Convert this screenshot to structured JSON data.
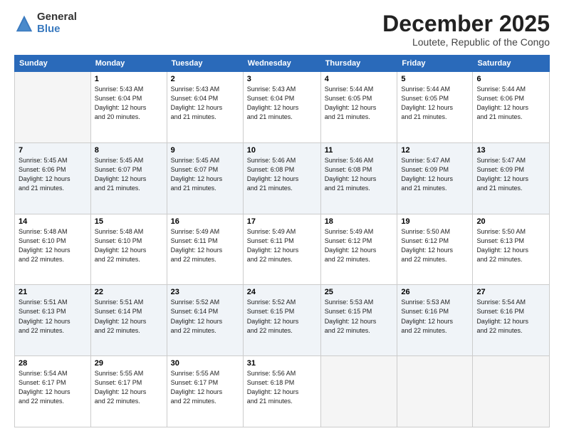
{
  "logo": {
    "general": "General",
    "blue": "Blue"
  },
  "title": "December 2025",
  "location": "Loutete, Republic of the Congo",
  "days_header": [
    "Sunday",
    "Monday",
    "Tuesday",
    "Wednesday",
    "Thursday",
    "Friday",
    "Saturday"
  ],
  "weeks": [
    [
      {
        "num": "",
        "info": ""
      },
      {
        "num": "1",
        "info": "Sunrise: 5:43 AM\nSunset: 6:04 PM\nDaylight: 12 hours\nand 20 minutes."
      },
      {
        "num": "2",
        "info": "Sunrise: 5:43 AM\nSunset: 6:04 PM\nDaylight: 12 hours\nand 21 minutes."
      },
      {
        "num": "3",
        "info": "Sunrise: 5:43 AM\nSunset: 6:04 PM\nDaylight: 12 hours\nand 21 minutes."
      },
      {
        "num": "4",
        "info": "Sunrise: 5:44 AM\nSunset: 6:05 PM\nDaylight: 12 hours\nand 21 minutes."
      },
      {
        "num": "5",
        "info": "Sunrise: 5:44 AM\nSunset: 6:05 PM\nDaylight: 12 hours\nand 21 minutes."
      },
      {
        "num": "6",
        "info": "Sunrise: 5:44 AM\nSunset: 6:06 PM\nDaylight: 12 hours\nand 21 minutes."
      }
    ],
    [
      {
        "num": "7",
        "info": "Sunrise: 5:45 AM\nSunset: 6:06 PM\nDaylight: 12 hours\nand 21 minutes."
      },
      {
        "num": "8",
        "info": "Sunrise: 5:45 AM\nSunset: 6:07 PM\nDaylight: 12 hours\nand 21 minutes."
      },
      {
        "num": "9",
        "info": "Sunrise: 5:45 AM\nSunset: 6:07 PM\nDaylight: 12 hours\nand 21 minutes."
      },
      {
        "num": "10",
        "info": "Sunrise: 5:46 AM\nSunset: 6:08 PM\nDaylight: 12 hours\nand 21 minutes."
      },
      {
        "num": "11",
        "info": "Sunrise: 5:46 AM\nSunset: 6:08 PM\nDaylight: 12 hours\nand 21 minutes."
      },
      {
        "num": "12",
        "info": "Sunrise: 5:47 AM\nSunset: 6:09 PM\nDaylight: 12 hours\nand 21 minutes."
      },
      {
        "num": "13",
        "info": "Sunrise: 5:47 AM\nSunset: 6:09 PM\nDaylight: 12 hours\nand 21 minutes."
      }
    ],
    [
      {
        "num": "14",
        "info": "Sunrise: 5:48 AM\nSunset: 6:10 PM\nDaylight: 12 hours\nand 22 minutes."
      },
      {
        "num": "15",
        "info": "Sunrise: 5:48 AM\nSunset: 6:10 PM\nDaylight: 12 hours\nand 22 minutes."
      },
      {
        "num": "16",
        "info": "Sunrise: 5:49 AM\nSunset: 6:11 PM\nDaylight: 12 hours\nand 22 minutes."
      },
      {
        "num": "17",
        "info": "Sunrise: 5:49 AM\nSunset: 6:11 PM\nDaylight: 12 hours\nand 22 minutes."
      },
      {
        "num": "18",
        "info": "Sunrise: 5:49 AM\nSunset: 6:12 PM\nDaylight: 12 hours\nand 22 minutes."
      },
      {
        "num": "19",
        "info": "Sunrise: 5:50 AM\nSunset: 6:12 PM\nDaylight: 12 hours\nand 22 minutes."
      },
      {
        "num": "20",
        "info": "Sunrise: 5:50 AM\nSunset: 6:13 PM\nDaylight: 12 hours\nand 22 minutes."
      }
    ],
    [
      {
        "num": "21",
        "info": "Sunrise: 5:51 AM\nSunset: 6:13 PM\nDaylight: 12 hours\nand 22 minutes."
      },
      {
        "num": "22",
        "info": "Sunrise: 5:51 AM\nSunset: 6:14 PM\nDaylight: 12 hours\nand 22 minutes."
      },
      {
        "num": "23",
        "info": "Sunrise: 5:52 AM\nSunset: 6:14 PM\nDaylight: 12 hours\nand 22 minutes."
      },
      {
        "num": "24",
        "info": "Sunrise: 5:52 AM\nSunset: 6:15 PM\nDaylight: 12 hours\nand 22 minutes."
      },
      {
        "num": "25",
        "info": "Sunrise: 5:53 AM\nSunset: 6:15 PM\nDaylight: 12 hours\nand 22 minutes."
      },
      {
        "num": "26",
        "info": "Sunrise: 5:53 AM\nSunset: 6:16 PM\nDaylight: 12 hours\nand 22 minutes."
      },
      {
        "num": "27",
        "info": "Sunrise: 5:54 AM\nSunset: 6:16 PM\nDaylight: 12 hours\nand 22 minutes."
      }
    ],
    [
      {
        "num": "28",
        "info": "Sunrise: 5:54 AM\nSunset: 6:17 PM\nDaylight: 12 hours\nand 22 minutes."
      },
      {
        "num": "29",
        "info": "Sunrise: 5:55 AM\nSunset: 6:17 PM\nDaylight: 12 hours\nand 22 minutes."
      },
      {
        "num": "30",
        "info": "Sunrise: 5:55 AM\nSunset: 6:17 PM\nDaylight: 12 hours\nand 22 minutes."
      },
      {
        "num": "31",
        "info": "Sunrise: 5:56 AM\nSunset: 6:18 PM\nDaylight: 12 hours\nand 21 minutes."
      },
      {
        "num": "",
        "info": ""
      },
      {
        "num": "",
        "info": ""
      },
      {
        "num": "",
        "info": ""
      }
    ]
  ]
}
